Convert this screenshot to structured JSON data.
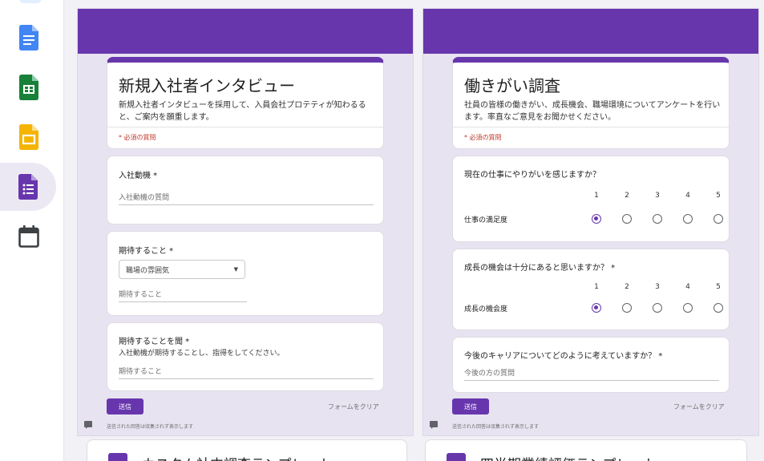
{
  "rail": {
    "items": [
      {
        "icon": "google-docs-icon",
        "color": "#4285f4"
      },
      {
        "icon": "google-sheets-icon",
        "color": "#188038"
      },
      {
        "icon": "google-slides-icon",
        "color": "#f4b400"
      },
      {
        "icon": "google-forms-icon",
        "color": "#6736ad",
        "active": true
      },
      {
        "icon": "calendar-icon",
        "color": "#3c4043"
      }
    ]
  },
  "colors": {
    "accent": "#6736ad",
    "panel_bg": "#e8e3f1"
  },
  "left_form": {
    "title": "新規入社者インタビュー",
    "description": "新規入社者インタビューを採用して、入員会社プロテティが知わるると、ご案内を願重します。",
    "required_note": "* 必須の質問",
    "q1": {
      "title": "入社動機 *",
      "placeholder": "入社動機の質問"
    },
    "q2": {
      "title": "期待すること *",
      "dropdown_value": "職場の雰囲気",
      "input_placeholder": "期待すること"
    },
    "q3": {
      "title": "期待することを聞 *",
      "subtitle": "入社動機が期待することし、指得をしてください。",
      "input_placeholder": "期待すること"
    },
    "submit_label": "送信",
    "clear_label": "フォームをクリア",
    "footer_note": "送信された回答は収集されず表示します"
  },
  "right_form": {
    "title": "働きがい調査",
    "description": "社員の皆様の働きがい、成長機会、職場環境についてアンケートを行います。率直なご意見をお聞かせください。",
    "required_note": "* 必須の質問",
    "scale_numbers": [
      "1",
      "2",
      "3",
      "4",
      "5"
    ],
    "q1": {
      "title": "現在の仕事にやりがいを感じますか？",
      "row_label": "仕事の満足度",
      "selected": 1
    },
    "q2": {
      "title": "成長の機会は十分にあると思いますか？ *",
      "row_label": "成長の機会度",
      "selected": 1
    },
    "q3": {
      "title": "今後のキャリアについてどのように考えていますか？ *",
      "placeholder": "今後の方の質問"
    },
    "submit_label": "送信",
    "clear_label": "フォームをクリア",
    "footer_note": "送信された回答は収集されず表示します"
  },
  "bottom_cards": [
    {
      "text": "カスタム社内調査テンプレート"
    },
    {
      "text": "四半期業績評価テンプレート"
    }
  ]
}
